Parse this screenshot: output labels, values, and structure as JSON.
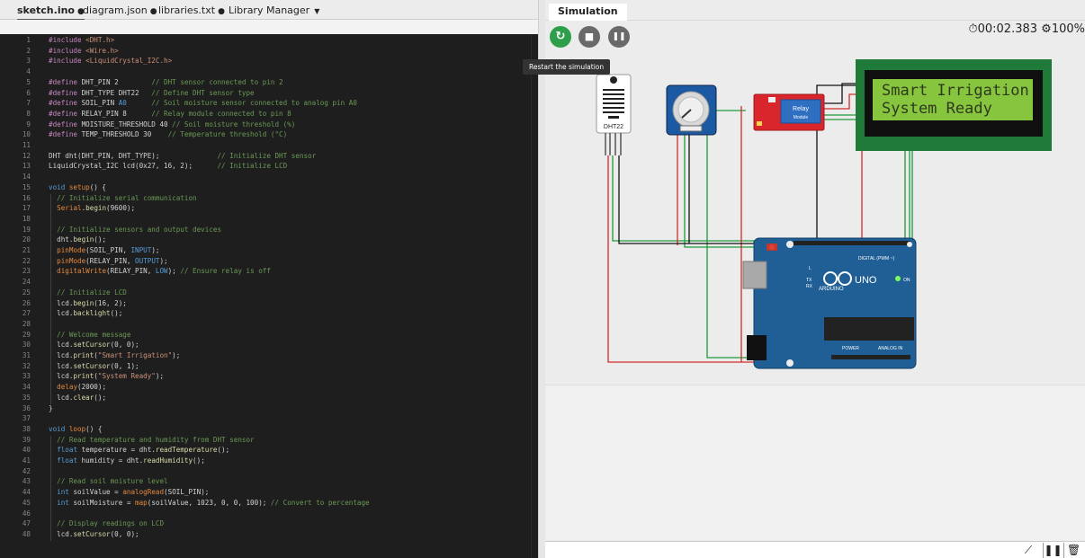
{
  "editor": {
    "tabs": [
      {
        "label": "sketch.ino",
        "modified_marker": "●"
      },
      {
        "label": "diagram.json",
        "modified_marker": "●"
      },
      {
        "label": "libraries.txt",
        "modified_marker": "●"
      },
      {
        "label": "Library Manager",
        "modified_marker": ""
      }
    ],
    "lines": [
      {
        "n": "1",
        "tokens": [
          [
            "pp",
            "#include "
          ],
          [
            "str",
            "<DHT.h>"
          ]
        ]
      },
      {
        "n": "2",
        "tokens": [
          [
            "pp",
            "#include "
          ],
          [
            "str",
            "<Wire.h>"
          ]
        ]
      },
      {
        "n": "3",
        "tokens": [
          [
            "pp",
            "#include "
          ],
          [
            "str",
            "<LiquidCrystal_I2C.h>"
          ]
        ]
      },
      {
        "n": "4",
        "tokens": []
      },
      {
        "n": "5",
        "tokens": [
          [
            "pp",
            "#define "
          ],
          [
            "pl",
            "DHT_PIN 2        "
          ],
          [
            "cm",
            "// DHT sensor connected to pin 2"
          ]
        ]
      },
      {
        "n": "6",
        "tokens": [
          [
            "pp",
            "#define "
          ],
          [
            "pl",
            "DHT_TYPE DHT22   "
          ],
          [
            "cm",
            "// Define DHT sensor type"
          ]
        ]
      },
      {
        "n": "7",
        "tokens": [
          [
            "pp",
            "#define "
          ],
          [
            "pl",
            "SOIL_PIN "
          ],
          [
            "kw",
            "A0"
          ],
          [
            "pl",
            "      "
          ],
          [
            "cm",
            "// Soil moisture sensor connected to analog pin A0"
          ]
        ]
      },
      {
        "n": "8",
        "tokens": [
          [
            "pp",
            "#define "
          ],
          [
            "pl",
            "RELAY_PIN 8      "
          ],
          [
            "cm",
            "// Relay module connected to pin 8"
          ]
        ]
      },
      {
        "n": "9",
        "tokens": [
          [
            "pp",
            "#define "
          ],
          [
            "pl",
            "MOISTURE_THRESHOLD 40 "
          ],
          [
            "cm",
            "// Soil moisture threshold (%)"
          ]
        ]
      },
      {
        "n": "10",
        "tokens": [
          [
            "pp",
            "#define "
          ],
          [
            "pl",
            "TEMP_THRESHOLD 30    "
          ],
          [
            "cm",
            "// Temperature threshold (°C)"
          ]
        ]
      },
      {
        "n": "11",
        "tokens": []
      },
      {
        "n": "12",
        "tokens": [
          [
            "pl",
            "DHT dht(DHT_PIN, DHT_TYPE);              "
          ],
          [
            "cm",
            "// Initialize DHT sensor"
          ]
        ]
      },
      {
        "n": "13",
        "tokens": [
          [
            "pl",
            "LiquidCrystal_I2C lcd(0x27, 16, 2);      "
          ],
          [
            "cm",
            "// Initialize LCD"
          ]
        ]
      },
      {
        "n": "14",
        "tokens": []
      },
      {
        "n": "15",
        "tokens": [
          [
            "kw",
            "void "
          ],
          [
            "org",
            "setup"
          ],
          [
            "pl",
            "() {"
          ]
        ]
      },
      {
        "n": "16",
        "tokens": [
          [
            "pl",
            "  "
          ],
          [
            "cm",
            "// Initialize serial communication"
          ]
        ]
      },
      {
        "n": "17",
        "tokens": [
          [
            "pl",
            "  "
          ],
          [
            "org",
            "Serial"
          ],
          [
            "pl",
            "."
          ],
          [
            "fn",
            "begin"
          ],
          [
            "pl",
            "(9600);"
          ]
        ]
      },
      {
        "n": "18",
        "tokens": []
      },
      {
        "n": "19",
        "tokens": [
          [
            "pl",
            "  "
          ],
          [
            "cm",
            "// Initialize sensors and output devices"
          ]
        ]
      },
      {
        "n": "20",
        "tokens": [
          [
            "pl",
            "  dht."
          ],
          [
            "fn",
            "begin"
          ],
          [
            "pl",
            "();"
          ]
        ]
      },
      {
        "n": "21",
        "tokens": [
          [
            "pl",
            "  "
          ],
          [
            "org",
            "pinMode"
          ],
          [
            "pl",
            "(SOIL_PIN, "
          ],
          [
            "kw",
            "INPUT"
          ],
          [
            "pl",
            ");"
          ]
        ]
      },
      {
        "n": "22",
        "tokens": [
          [
            "pl",
            "  "
          ],
          [
            "org",
            "pinMode"
          ],
          [
            "pl",
            "(RELAY_PIN, "
          ],
          [
            "kw",
            "OUTPUT"
          ],
          [
            "pl",
            ");"
          ]
        ]
      },
      {
        "n": "23",
        "tokens": [
          [
            "pl",
            "  "
          ],
          [
            "org",
            "digitalWrite"
          ],
          [
            "pl",
            "(RELAY_PIN, "
          ],
          [
            "kw",
            "LOW"
          ],
          [
            "pl",
            "); "
          ],
          [
            "cm",
            "// Ensure relay is off"
          ]
        ]
      },
      {
        "n": "24",
        "tokens": []
      },
      {
        "n": "25",
        "tokens": [
          [
            "pl",
            "  "
          ],
          [
            "cm",
            "// Initialize LCD"
          ]
        ]
      },
      {
        "n": "26",
        "tokens": [
          [
            "pl",
            "  lcd."
          ],
          [
            "fn",
            "begin"
          ],
          [
            "pl",
            "(16, 2);"
          ]
        ]
      },
      {
        "n": "27",
        "tokens": [
          [
            "pl",
            "  lcd."
          ],
          [
            "fn",
            "backlight"
          ],
          [
            "pl",
            "();"
          ]
        ]
      },
      {
        "n": "28",
        "tokens": []
      },
      {
        "n": "29",
        "tokens": [
          [
            "pl",
            "  "
          ],
          [
            "cm",
            "// Welcome message"
          ]
        ]
      },
      {
        "n": "30",
        "tokens": [
          [
            "pl",
            "  lcd."
          ],
          [
            "fn",
            "setCursor"
          ],
          [
            "pl",
            "(0, 0);"
          ]
        ]
      },
      {
        "n": "31",
        "tokens": [
          [
            "pl",
            "  lcd."
          ],
          [
            "fn",
            "print"
          ],
          [
            "pl",
            "("
          ],
          [
            "str",
            "\"Smart Irrigation\""
          ],
          [
            "pl",
            ");"
          ]
        ]
      },
      {
        "n": "32",
        "tokens": [
          [
            "pl",
            "  lcd."
          ],
          [
            "fn",
            "setCursor"
          ],
          [
            "pl",
            "(0, 1);"
          ]
        ]
      },
      {
        "n": "33",
        "tokens": [
          [
            "pl",
            "  lcd."
          ],
          [
            "fn",
            "print"
          ],
          [
            "pl",
            "("
          ],
          [
            "str",
            "\"System Ready\""
          ],
          [
            "pl",
            ");"
          ]
        ]
      },
      {
        "n": "34",
        "tokens": [
          [
            "pl",
            "  "
          ],
          [
            "org",
            "delay"
          ],
          [
            "pl",
            "(2000);"
          ]
        ]
      },
      {
        "n": "35",
        "tokens": [
          [
            "pl",
            "  lcd."
          ],
          [
            "fn",
            "clear"
          ],
          [
            "pl",
            "();"
          ]
        ]
      },
      {
        "n": "36",
        "tokens": [
          [
            "pl",
            "}"
          ]
        ]
      },
      {
        "n": "37",
        "tokens": []
      },
      {
        "n": "38",
        "tokens": [
          [
            "kw",
            "void "
          ],
          [
            "org",
            "loop"
          ],
          [
            "pl",
            "() {"
          ]
        ]
      },
      {
        "n": "39",
        "tokens": [
          [
            "pl",
            "  "
          ],
          [
            "cm",
            "// Read temperature and humidity from DHT sensor"
          ]
        ]
      },
      {
        "n": "40",
        "tokens": [
          [
            "pl",
            "  "
          ],
          [
            "kw",
            "float "
          ],
          [
            "pl",
            "temperature = dht."
          ],
          [
            "fn",
            "readTemperature"
          ],
          [
            "pl",
            "();"
          ]
        ]
      },
      {
        "n": "41",
        "tokens": [
          [
            "pl",
            "  "
          ],
          [
            "kw",
            "float "
          ],
          [
            "pl",
            "humidity = dht."
          ],
          [
            "fn",
            "readHumidity"
          ],
          [
            "pl",
            "();"
          ]
        ]
      },
      {
        "n": "42",
        "tokens": []
      },
      {
        "n": "43",
        "tokens": [
          [
            "pl",
            "  "
          ],
          [
            "cm",
            "// Read soil moisture level"
          ]
        ]
      },
      {
        "n": "44",
        "tokens": [
          [
            "pl",
            "  "
          ],
          [
            "kw",
            "int "
          ],
          [
            "pl",
            "soilValue = "
          ],
          [
            "org",
            "analogRead"
          ],
          [
            "pl",
            "(SOIL_PIN);"
          ]
        ]
      },
      {
        "n": "45",
        "tokens": [
          [
            "pl",
            "  "
          ],
          [
            "kw",
            "int "
          ],
          [
            "pl",
            "soilMoisture = "
          ],
          [
            "org",
            "map"
          ],
          [
            "pl",
            "(soilValue, 1023, 0, 0, 100); "
          ],
          [
            "cm",
            "// Convert to percentage"
          ]
        ]
      },
      {
        "n": "46",
        "tokens": []
      },
      {
        "n": "47",
        "tokens": [
          [
            "pl",
            "  "
          ],
          [
            "cm",
            "// Display readings on LCD"
          ]
        ]
      },
      {
        "n": "48",
        "tokens": [
          [
            "pl",
            "  lcd."
          ],
          [
            "fn",
            "setCursor"
          ],
          [
            "pl",
            "(0, 0);"
          ]
        ]
      }
    ]
  },
  "simulation": {
    "tab_label": "Simulation",
    "tooltip": "Restart the simulation",
    "timer": "00:02.383",
    "speed": "100%",
    "buttons": {
      "restart": "↻",
      "stop": "■",
      "pause": "❚❚"
    },
    "console_tools": {
      "plot": "⟋",
      "pause": "❚❚",
      "clear": "🗑"
    },
    "parts": {
      "dht_label": "DHT22",
      "relay_label": "Relay",
      "relay_module_label": "Module",
      "lcd_line1": "Smart Irrigation",
      "lcd_line2": "System Ready",
      "arduino_brand": "ARDUINO",
      "arduino_model": "UNO",
      "digital_label": "DIGITAL (PWM ~)",
      "analog_label": "ANALOG IN",
      "power_label": "POWER",
      "tx_label": "TX",
      "rx_label": "RX",
      "l_label": "L",
      "on_label": "ON"
    },
    "colors": {
      "wire_green": "#1f9a3c",
      "wire_red": "#d12b2b",
      "wire_black": "#111111",
      "board_blue": "#1f5f95",
      "lcd_green": "#87c53e",
      "relay_red": "#d9262c"
    }
  }
}
